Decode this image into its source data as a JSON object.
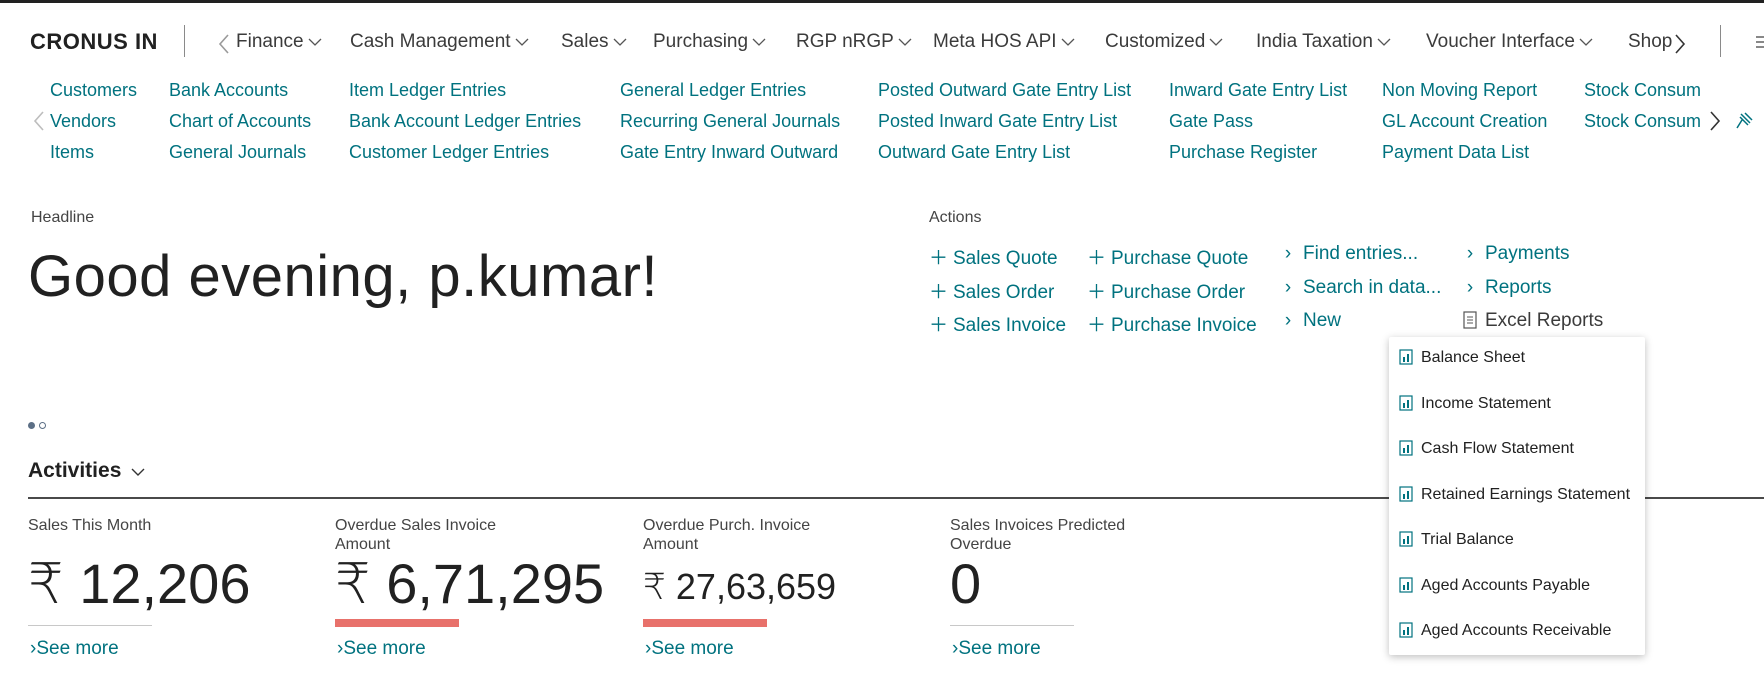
{
  "brand": "CRONUS IN",
  "menu": [
    {
      "label": "Finance"
    },
    {
      "label": "Cash Management"
    },
    {
      "label": "Sales"
    },
    {
      "label": "Purchasing"
    },
    {
      "label": "RGP nRGP"
    },
    {
      "label": "Meta HOS API"
    },
    {
      "label": "Customized"
    },
    {
      "label": "India Taxation"
    },
    {
      "label": "Voucher Interface"
    },
    {
      "label": "Shop"
    }
  ],
  "sublinks": {
    "col1": [
      "Customers",
      "Vendors",
      "Items"
    ],
    "col2": [
      "Bank Accounts",
      "Chart of Accounts",
      "General Journals"
    ],
    "col3": [
      "Item Ledger Entries",
      "Bank Account Ledger Entries",
      "Customer Ledger Entries"
    ],
    "col4": [
      "General Ledger Entries",
      "Recurring General Journals",
      "Gate Entry Inward Outward"
    ],
    "col5": [
      "Posted Outward Gate Entry List",
      "Posted Inward Gate Entry List",
      "Outward Gate Entry List"
    ],
    "col6": [
      "Inward Gate Entry List",
      "Gate Pass",
      "Purchase Register"
    ],
    "col7": [
      "Non Moving Report",
      "GL Account Creation",
      "Payment Data List"
    ],
    "col8": [
      "Stock Consum",
      "Stock Consum"
    ]
  },
  "headline": {
    "label": "Headline",
    "text": "Good evening, p.kumar!"
  },
  "actions": {
    "label": "Actions",
    "col1": [
      "Sales Quote",
      "Sales Order",
      "Sales Invoice"
    ],
    "col2": [
      "Purchase Quote",
      "Purchase Order",
      "Purchase Invoice"
    ],
    "col3": [
      "Find entries...",
      "Search in data...",
      "New"
    ],
    "col4": [
      "Payments",
      "Reports",
      "Excel Reports"
    ]
  },
  "excel_reports_menu": [
    "Balance Sheet",
    "Income Statement",
    "Cash Flow Statement",
    "Retained Earnings Statement",
    "Trial Balance",
    "Aged Accounts Payable",
    "Aged Accounts Receivable"
  ],
  "activities": {
    "title": "Activities",
    "see_more": "See more",
    "tiles": [
      {
        "label": "Sales This Month",
        "value": "₹ 12,206",
        "status": "neutral"
      },
      {
        "label": "Overdue Sales Invoice Amount",
        "value": "₹ 6,71,295",
        "status": "alert"
      },
      {
        "label": "Overdue Purch. Invoice Amount",
        "value": "₹ 27,63,659",
        "status": "alert"
      },
      {
        "label": "Sales Invoices Predicted Overdue",
        "value": "0",
        "status": "neutral"
      }
    ]
  },
  "colors": {
    "accent": "#00727f",
    "alert_bar": "#e8716b",
    "neutral_bar": "#c8c8c8",
    "dot_active": "#5c6f86"
  },
  "icons": {
    "pin": "pin-icon",
    "report": "report-icon",
    "excel_report": "excel-report-icon"
  }
}
